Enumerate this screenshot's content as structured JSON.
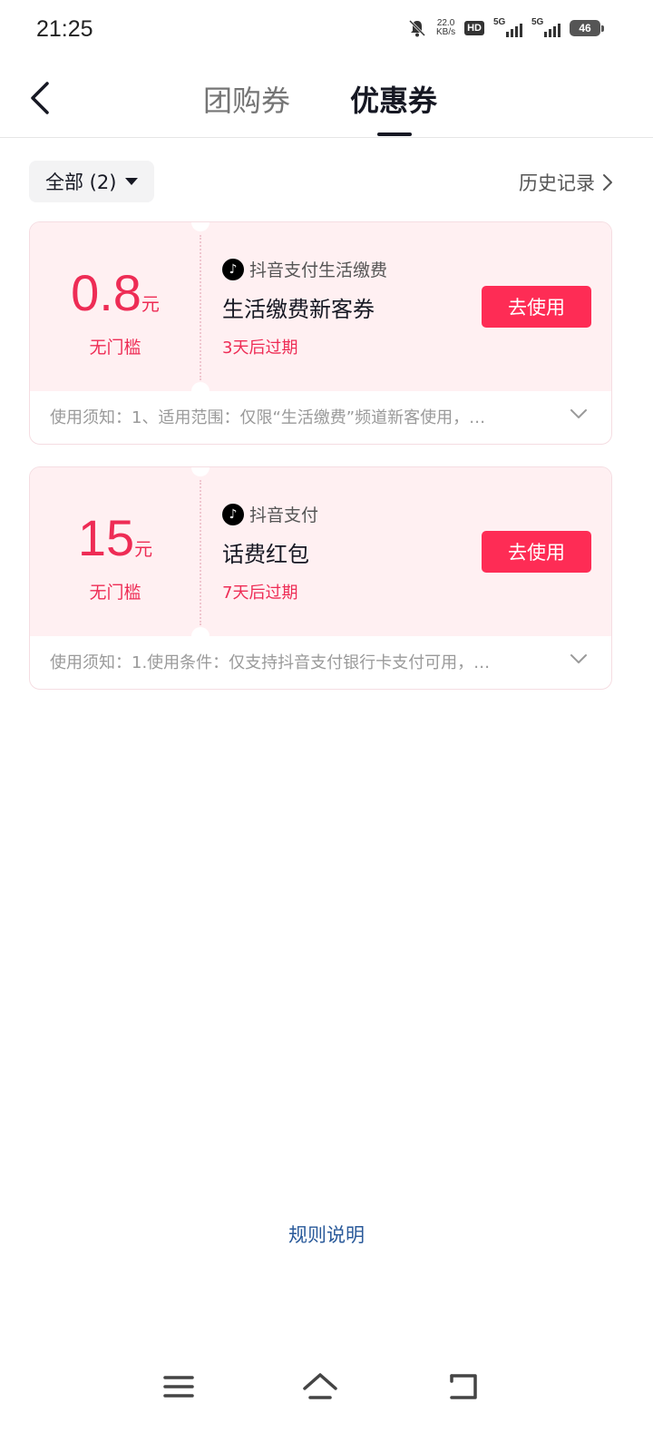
{
  "status_bar": {
    "time": "21:25",
    "net_speed": "22.0",
    "net_unit": "KB/s",
    "hd": "HD",
    "sim1": "5G",
    "sim2": "5G",
    "battery": "46"
  },
  "header": {
    "back_icon": "chevron-left-icon",
    "tabs": [
      {
        "label": "团购券",
        "active": false
      },
      {
        "label": "优惠券",
        "active": true
      }
    ]
  },
  "filter": {
    "label": "全部 (2)",
    "history_label": "历史记录"
  },
  "coupons": [
    {
      "amount": "0.8",
      "unit": "元",
      "threshold": "无门槛",
      "brand": "抖音支付生活缴费",
      "title": "生活缴费新客券",
      "expiry": "3天后过期",
      "button": "去使用",
      "notice": "使用须知：1、适用范围：仅限“生活缴费”频道新客使用，…"
    },
    {
      "amount": "15",
      "unit": "元",
      "threshold": "无门槛",
      "brand": "抖音支付",
      "title": "话费红包",
      "expiry": "7天后过期",
      "button": "去使用",
      "notice": "使用须知：1.使用条件：仅支持抖音支付银行卡支付可用，…"
    }
  ],
  "footer": {
    "rules_label": "规则说明"
  },
  "colors": {
    "accent": "#fe2c55",
    "price": "#ee2c55",
    "card_bg": "#fff0f2",
    "link": "#2a5a9a"
  }
}
